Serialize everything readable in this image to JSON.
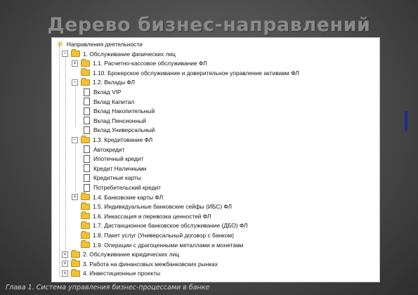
{
  "slide": {
    "title": "Дерево бизнес-направлений",
    "caption": "Глава 1. Система управления бизнес-процессами в банке"
  },
  "colors": {
    "background": "#4a4a4a",
    "title": "#8b8b8b",
    "folder": "#f2c233",
    "accent_bar": "#1f2d8c"
  },
  "tree": {
    "root_icon": "asterisk-icon",
    "items": [
      {
        "label": "Направления деятельности",
        "level": 0,
        "icon": "root",
        "expander": ""
      },
      {
        "label": "1. Обслуживание физических лиц",
        "level": 1,
        "icon": "folder",
        "expander": "−"
      },
      {
        "label": "1.1. Расчетно-кассовое обслуживание ФЛ",
        "level": 2,
        "icon": "folder",
        "expander": "+"
      },
      {
        "label": "1.10. Брокерское обслуживание и доверительное управление активами ФЛ",
        "level": 2,
        "icon": "folder",
        "expander": ""
      },
      {
        "label": "1.2. Вклады ФЛ",
        "level": 2,
        "icon": "folder",
        "expander": "−"
      },
      {
        "label": "Вклад VIP",
        "level": 3,
        "icon": "doc",
        "expander": ""
      },
      {
        "label": "Вклад Капитал",
        "level": 3,
        "icon": "doc",
        "expander": ""
      },
      {
        "label": "Вклад Накопительный",
        "level": 3,
        "icon": "doc",
        "expander": ""
      },
      {
        "label": "Вклад Пенсионный",
        "level": 3,
        "icon": "doc",
        "expander": ""
      },
      {
        "label": "Вклад Универсальный",
        "level": 3,
        "icon": "doc",
        "expander": ""
      },
      {
        "label": "1.3. Кредитование ФЛ",
        "level": 2,
        "icon": "folder",
        "expander": "−"
      },
      {
        "label": "Автокредит",
        "level": 3,
        "icon": "doc",
        "expander": ""
      },
      {
        "label": "Ипотечный кредит",
        "level": 3,
        "icon": "doc",
        "expander": ""
      },
      {
        "label": "Кредит Наличными",
        "level": 3,
        "icon": "doc",
        "expander": ""
      },
      {
        "label": "Кредитные карты",
        "level": 3,
        "icon": "doc",
        "expander": ""
      },
      {
        "label": "Потребительский кредит",
        "level": 3,
        "icon": "doc",
        "expander": ""
      },
      {
        "label": "1.4. Банковские карты ФЛ",
        "level": 2,
        "icon": "folder",
        "expander": "+"
      },
      {
        "label": "1.5. Индивидуальные банковские сейфы (ИБС) ФЛ",
        "level": 2,
        "icon": "folder",
        "expander": ""
      },
      {
        "label": "1.6. Инкассация и перевозка ценностей ФЛ",
        "level": 2,
        "icon": "folder",
        "expander": ""
      },
      {
        "label": "1.7. Дистанционное банковское обслуживание (ДБО) ФЛ",
        "level": 2,
        "icon": "folder",
        "expander": ""
      },
      {
        "label": "1.8. Пакет услуг (Универсальный договор с банком)",
        "level": 2,
        "icon": "folder",
        "expander": ""
      },
      {
        "label": "1.9. Операции с драгоценными металлами и монетами",
        "level": 2,
        "icon": "folder",
        "expander": ""
      },
      {
        "label": "2. Обслуживание юридических лиц",
        "level": 1,
        "icon": "folder",
        "expander": "+"
      },
      {
        "label": "3. Работа на финансовых межбанковских рынках",
        "level": 1,
        "icon": "folder",
        "expander": "+"
      },
      {
        "label": "4. Инвестиционные проекты",
        "level": 1,
        "icon": "folder",
        "expander": "+"
      }
    ]
  }
}
